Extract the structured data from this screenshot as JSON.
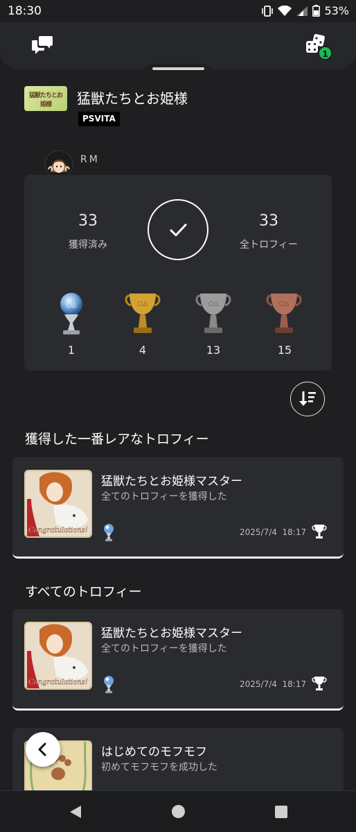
{
  "status_bar": {
    "time": "18:30",
    "battery": "53%"
  },
  "header": {
    "chat_icon": "chat-bubbles-icon",
    "dice_icon": "dice-icon",
    "dice_badge": "1"
  },
  "game": {
    "thumb_text": "猛獣たちとお姫様",
    "title": "猛獣たちとお姫様",
    "platform": "PSVITA"
  },
  "user": {
    "name": "RM"
  },
  "summary": {
    "earned_count": "33",
    "earned_label": "獲得済み",
    "total_count": "33",
    "total_label": "全トロフィー",
    "trophies": [
      {
        "type": "platinum",
        "count": "1",
        "color": "#b9d6f0"
      },
      {
        "type": "gold",
        "count": "4",
        "color": "#d4a233"
      },
      {
        "type": "silver",
        "count": "13",
        "color": "#9c9c9c"
      },
      {
        "type": "bronze",
        "count": "15",
        "color": "#b0705a"
      }
    ]
  },
  "sections": {
    "rarest_title": "獲得した一番レアなトロフィー",
    "all_title": "すべてのトロフィー"
  },
  "rarest_trophy": {
    "name": "猛獣たちとお姫様マスター",
    "description": "全てのトロフィーを獲得した",
    "date": "2025/7/4",
    "time": "18:17",
    "image_caption": "Congratulations!"
  },
  "all_trophies": [
    {
      "name": "猛獣たちとお姫様マスター",
      "description": "全てのトロフィーを獲得した",
      "date": "2025/7/4",
      "time": "18:17",
      "image_caption": "Congratulations!"
    },
    {
      "name": "はじめてのモフモフ",
      "description": "初めてモフモフを成功した"
    }
  ],
  "colors": {
    "accent_green": "#1db954",
    "card_bg": "#2a2b2f",
    "page_bg": "#1f1f22"
  }
}
